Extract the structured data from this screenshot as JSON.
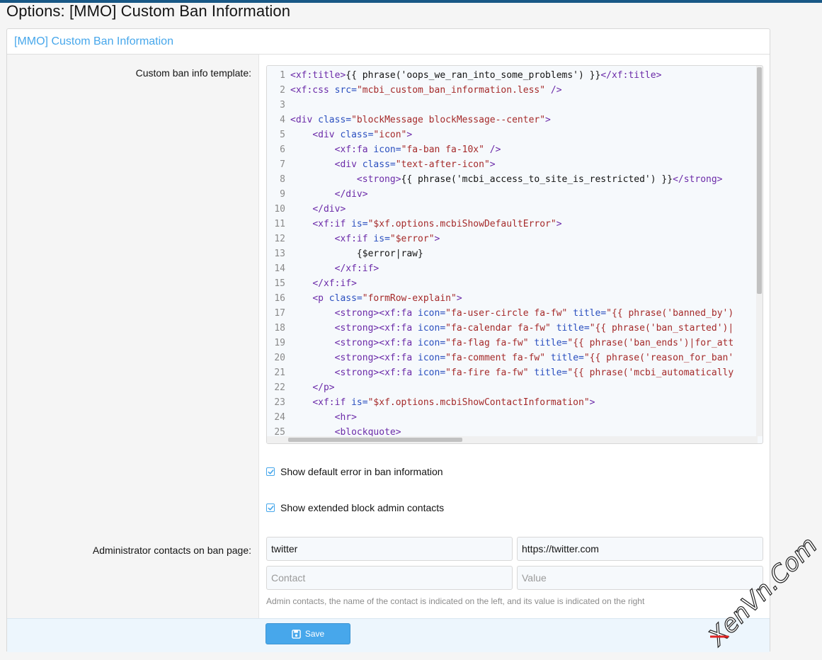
{
  "page": {
    "title": "Options: [MMO] Custom Ban Information"
  },
  "block": {
    "header": "[MMO] Custom Ban Information"
  },
  "template_row": {
    "label": "Custom ban info template:",
    "code_lines": [
      {
        "n": "1",
        "html": "<span class=\"t\">&lt;xf:title&gt;</span>{{ phrase('oops_we_ran_into_some_problems') }}<span class=\"t\">&lt;/xf:title&gt;</span>"
      },
      {
        "n": "2",
        "html": "<span class=\"t\">&lt;xf:css</span> <span class=\"a\">src=</span><span class=\"s\">\"mcbi_custom_ban_information.less\"</span> <span class=\"t\">/&gt;</span>"
      },
      {
        "n": "3",
        "html": ""
      },
      {
        "n": "4",
        "html": "<span class=\"t\">&lt;div</span> <span class=\"a\">class=</span><span class=\"s\">\"blockMessage blockMessage--center\"</span><span class=\"t\">&gt;</span>"
      },
      {
        "n": "5",
        "html": "    <span class=\"t\">&lt;div</span> <span class=\"a\">class=</span><span class=\"s\">\"icon\"</span><span class=\"t\">&gt;</span>"
      },
      {
        "n": "6",
        "html": "        <span class=\"t\">&lt;xf:fa</span> <span class=\"a\">icon=</span><span class=\"s\">\"fa-ban fa-10x\"</span> <span class=\"t\">/&gt;</span>"
      },
      {
        "n": "7",
        "html": "        <span class=\"t\">&lt;div</span> <span class=\"a\">class=</span><span class=\"s\">\"text-after-icon\"</span><span class=\"t\">&gt;</span>"
      },
      {
        "n": "8",
        "html": "            <span class=\"t\">&lt;strong&gt;</span>{{ phrase('mcbi_access_to_site_is_restricted') }}<span class=\"t\">&lt;/strong&gt;</span>"
      },
      {
        "n": "9",
        "html": "        <span class=\"t\">&lt;/div&gt;</span>"
      },
      {
        "n": "10",
        "html": "    <span class=\"t\">&lt;/div&gt;</span>"
      },
      {
        "n": "11",
        "html": "    <span class=\"t\">&lt;xf:if</span> <span class=\"a\">is=</span><span class=\"s\">\"$xf.options.mcbiShowDefaultError\"</span><span class=\"t\">&gt;</span>"
      },
      {
        "n": "12",
        "html": "        <span class=\"t\">&lt;xf:if</span> <span class=\"a\">is=</span><span class=\"s\">\"$error\"</span><span class=\"t\">&gt;</span>"
      },
      {
        "n": "13",
        "html": "            {$error|raw}"
      },
      {
        "n": "14",
        "html": "        <span class=\"t\">&lt;/xf:if&gt;</span>"
      },
      {
        "n": "15",
        "html": "    <span class=\"t\">&lt;/xf:if&gt;</span>"
      },
      {
        "n": "16",
        "html": "    <span class=\"t\">&lt;p</span> <span class=\"a\">class=</span><span class=\"s\">\"formRow-explain\"</span><span class=\"t\">&gt;</span>"
      },
      {
        "n": "17",
        "html": "        <span class=\"t\">&lt;strong&gt;&lt;xf:fa</span> <span class=\"a\">icon=</span><span class=\"s\">\"fa-user-circle fa-fw\"</span> <span class=\"a\">title=</span><span class=\"s\">\"{{ phrase('banned_by')</span>"
      },
      {
        "n": "18",
        "html": "        <span class=\"t\">&lt;strong&gt;&lt;xf:fa</span> <span class=\"a\">icon=</span><span class=\"s\">\"fa-calendar fa-fw\"</span> <span class=\"a\">title=</span><span class=\"s\">\"{{ phrase('ban_started')|</span>"
      },
      {
        "n": "19",
        "html": "        <span class=\"t\">&lt;strong&gt;&lt;xf:fa</span> <span class=\"a\">icon=</span><span class=\"s\">\"fa-flag fa-fw\"</span> <span class=\"a\">title=</span><span class=\"s\">\"{{ phrase('ban_ends')|for_att</span>"
      },
      {
        "n": "20",
        "html": "        <span class=\"t\">&lt;strong&gt;&lt;xf:fa</span> <span class=\"a\">icon=</span><span class=\"s\">\"fa-comment fa-fw\"</span> <span class=\"a\">title=</span><span class=\"s\">\"{{ phrase('reason_for_ban'</span>"
      },
      {
        "n": "21",
        "html": "        <span class=\"t\">&lt;strong&gt;&lt;xf:fa</span> <span class=\"a\">icon=</span><span class=\"s\">\"fa-fire fa-fw\"</span> <span class=\"a\">title=</span><span class=\"s\">\"{{ phrase('mcbi_automatically</span>"
      },
      {
        "n": "22",
        "html": "    <span class=\"t\">&lt;/p&gt;</span>"
      },
      {
        "n": "23",
        "html": "    <span class=\"t\">&lt;xf:if</span> <span class=\"a\">is=</span><span class=\"s\">\"$xf.options.mcbiShowContactInformation\"</span><span class=\"t\">&gt;</span>"
      },
      {
        "n": "24",
        "html": "        <span class=\"t\">&lt;hr&gt;</span>"
      },
      {
        "n": "25",
        "html": "        <span class=\"t\">&lt;blockquote&gt;</span>"
      }
    ]
  },
  "options": {
    "show_default_error": "Show default error in ban information",
    "show_extended_contacts": "Show extended block admin contacts"
  },
  "contacts_row": {
    "label": "Administrator contacts on ban page:",
    "row1_contact": "twitter",
    "row1_value": "https://twitter.com",
    "contact_placeholder": "Contact",
    "value_placeholder": "Value",
    "explain": "Admin contacts, the name of the contact is indicated on the left, and its value is indicated on the right"
  },
  "footer": {
    "save_label": "Save"
  },
  "watermark": {
    "text": "XenVn.Com"
  },
  "colors": {
    "accent": "#47a7eb",
    "tag": "#6b2aa8",
    "attr": "#2a4fbf",
    "string": "#a52a2a"
  }
}
